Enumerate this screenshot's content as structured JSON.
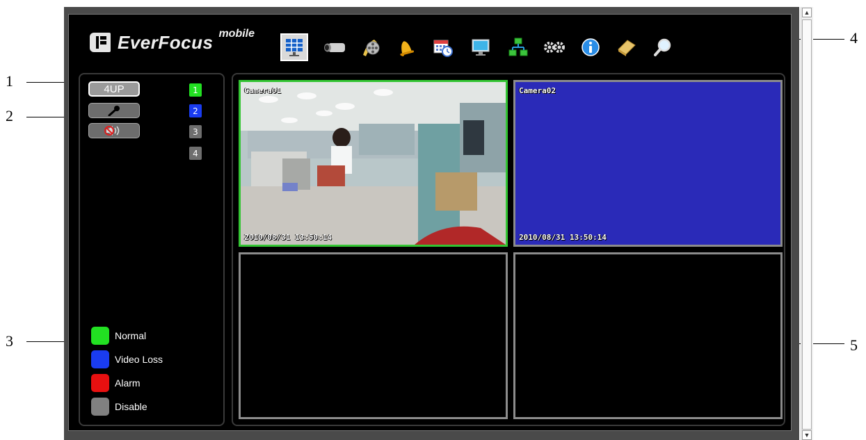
{
  "callouts": [
    "1",
    "2",
    "3",
    "4",
    "5"
  ],
  "brand": {
    "name": "EverFocus",
    "suffix": "mobile"
  },
  "toolbar": {
    "items": [
      {
        "name": "live-view",
        "icon": "grid-monitor-icon",
        "active": true
      },
      {
        "name": "camera",
        "icon": "camera-icon"
      },
      {
        "name": "playback",
        "icon": "film-reel-icon"
      },
      {
        "name": "alarm",
        "icon": "bell-icon"
      },
      {
        "name": "schedule",
        "icon": "calendar-clock-icon"
      },
      {
        "name": "display",
        "icon": "monitor-icon"
      },
      {
        "name": "network",
        "icon": "network-icon"
      },
      {
        "name": "settings",
        "icon": "gears-icon"
      },
      {
        "name": "info",
        "icon": "info-icon"
      },
      {
        "name": "notes",
        "icon": "notebook-icon"
      },
      {
        "name": "search",
        "icon": "magnifier-icon"
      }
    ]
  },
  "controls": {
    "layout_label": "4UP",
    "mic_icon": "microphone-icon",
    "speaker_icon": "speaker-muted-icon"
  },
  "channels": [
    {
      "label": "1",
      "status": "normal"
    },
    {
      "label": "2",
      "status": "video-loss"
    },
    {
      "label": "3",
      "status": "disable"
    },
    {
      "label": "4",
      "status": "disable"
    }
  ],
  "legend": [
    {
      "label": "Normal",
      "color": "#22e022"
    },
    {
      "label": "Video Loss",
      "color": "#1a3cf0"
    },
    {
      "label": "Alarm",
      "color": "#e81010"
    },
    {
      "label": "Disable",
      "color": "#808080"
    }
  ],
  "tiles": [
    {
      "camera": "Camera01",
      "timestamp": "2010/08/31  13:50:14",
      "state": "live"
    },
    {
      "camera": "Camera02",
      "timestamp": "2010/08/31  13:50:14",
      "state": "video-loss"
    },
    {
      "camera": "",
      "timestamp": "",
      "state": "empty"
    },
    {
      "camera": "",
      "timestamp": "",
      "state": "empty"
    }
  ],
  "colors": {
    "selected_border": "#33c533",
    "video_loss_bg": "#2a2ab8",
    "background": "#000000"
  }
}
